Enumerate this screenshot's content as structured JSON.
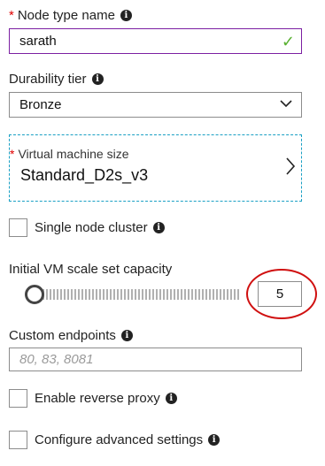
{
  "node_type": {
    "required_mark": "*",
    "label": "Node type name",
    "value": "sarath",
    "valid_icon": "checkmark-icon"
  },
  "durability": {
    "label": "Durability tier",
    "selected": "Bronze",
    "icon": "chevron-down-icon"
  },
  "vm_size": {
    "required_mark": "*",
    "label": "Virtual machine size",
    "value": "Standard_D2s_v3",
    "icon": "chevron-right-icon"
  },
  "single_node": {
    "label": "Single node cluster",
    "checked": false
  },
  "scale_set": {
    "label": "Initial VM scale set capacity",
    "value": "5",
    "slider_fraction": 0
  },
  "custom_endpoints": {
    "label": "Custom endpoints",
    "value": "",
    "placeholder": "80, 83, 8081"
  },
  "reverse_proxy": {
    "label": "Enable reverse proxy",
    "checked": false
  },
  "advanced": {
    "label": "Configure advanced settings",
    "checked": false
  },
  "colors": {
    "required": "#e00000",
    "valid_border": "#7b1fa2",
    "valid_check": "#58b030",
    "focus_dashed": "#1aa0c4",
    "annotation_circle": "#d01010"
  }
}
